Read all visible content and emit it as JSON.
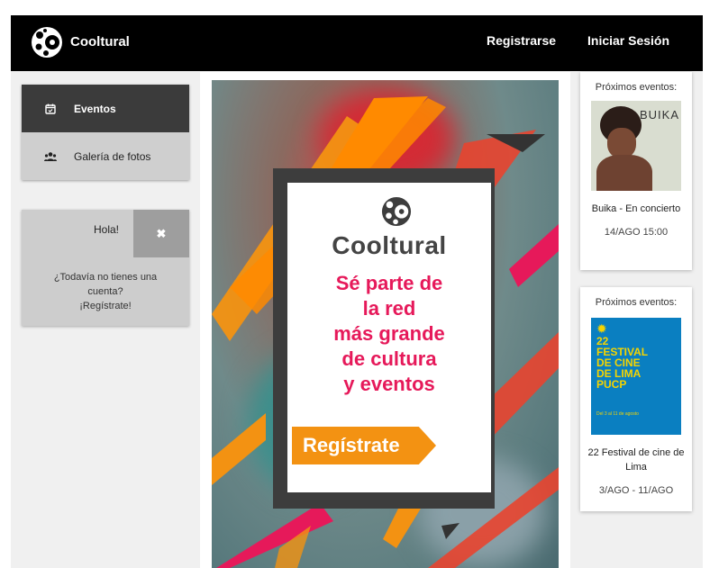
{
  "header": {
    "brand": "Cooltural",
    "nav_register": "Registrarse",
    "nav_login": "Iniciar Sesión"
  },
  "sidebar": {
    "items": [
      {
        "label": "Eventos",
        "icon": "calendar-icon",
        "active": true
      },
      {
        "label": "Galería de fotos",
        "icon": "users-icon",
        "active": false
      }
    ]
  },
  "hello_box": {
    "title": "Hola!",
    "close_icon": "close-icon",
    "message": "¿Todavía no tienes una cuenta?",
    "cta": "¡Regístrate!"
  },
  "promo": {
    "brand": "Cooltural",
    "headline": "Sé parte de\nla red\nmás  grande\nde cultura\ny eventos",
    "cta": "Regístrate",
    "colors": {
      "pink": "#e6195a",
      "orange": "#f39212",
      "dark": "#3d3d3d"
    }
  },
  "events": [
    {
      "heading": "Próximos eventos:",
      "title": "Buika - En concierto",
      "date": "14/AGO 15:00",
      "poster_text": "BUIKA"
    },
    {
      "heading": "Próximos eventos:",
      "title": "22 Festival de cine de Lima",
      "date": "3/AGO - 11/AGO",
      "poster_lines": [
        "22",
        "FESTIVAL",
        "DE CINE",
        "DE LIMA",
        "PUCP"
      ],
      "poster_sub": "Del 3 al 11 de agosto"
    }
  ]
}
